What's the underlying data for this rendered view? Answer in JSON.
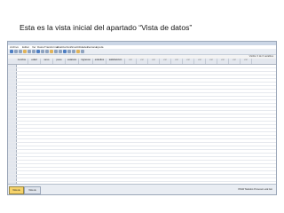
{
  "caption": "Esta es la vista inicial del apartado “Vista de datos”",
  "window": {
    "menu": [
      "Archivo",
      "Editar",
      "Ver",
      "Datos",
      "Transformar",
      "Analizar",
      "Gráficos",
      "Utilidades",
      "Ventana",
      "Ayuda"
    ],
    "top_right_info": "Visible: 0 de 0 variables"
  },
  "grid": {
    "columns": [
      "nombre",
      "edad",
      "sexo",
      "peso",
      "estatura",
      "ingresos",
      "estudios",
      "satisfacción",
      "var",
      "var",
      "var",
      "var",
      "var",
      "var",
      "var",
      "var",
      "var",
      "var",
      "var"
    ]
  },
  "footer": {
    "tab_data": "Vista de datos",
    "tab_vars": "Vista de variables",
    "status": "PASW Statistics Processor está listo"
  }
}
